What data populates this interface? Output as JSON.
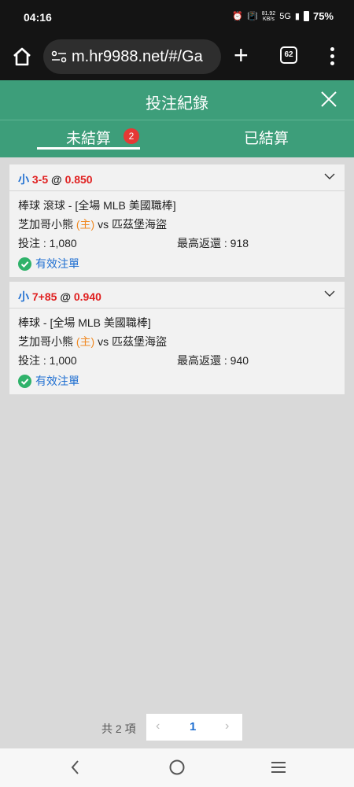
{
  "status": {
    "time": "04:16",
    "net_speed_top": "81.92",
    "net_speed_unit": "KB/s",
    "network": "5G",
    "battery": "75%"
  },
  "browser": {
    "url": "m.hr9988.net/#/Ga",
    "tab_count": "62"
  },
  "header": {
    "title": "投注紀錄"
  },
  "tabs": [
    {
      "label": "未結算",
      "badge": "2"
    },
    {
      "label": "已結算"
    }
  ],
  "bets": [
    {
      "pick_side": "小",
      "pick_line": "3-5",
      "at": "@",
      "odds": "0.850",
      "sport_line": "棒球 滾球 - [全場 MLB 美國職棒]",
      "home_team": "芝加哥小熊",
      "home_tag": "(主)",
      "vs": "vs",
      "away_team": "匹茲堡海盜",
      "stake_label": "投注 : 1,080",
      "return_label": "最高返還 : 918",
      "status": "有效注單"
    },
    {
      "pick_side": "小",
      "pick_line": "7+85",
      "at": "@",
      "odds": "0.940",
      "sport_line": "棒球 - [全場 MLB 美國職棒]",
      "home_team": "芝加哥小熊",
      "home_tag": "(主)",
      "vs": "vs",
      "away_team": "匹茲堡海盜",
      "stake_label": "投注 : 1,000",
      "return_label": "最高返還 : 940",
      "status": "有效注單"
    }
  ],
  "pagination": {
    "total": "共 2 項",
    "prev": "‹",
    "page": "1",
    "next": "›"
  },
  "colors": {
    "header_green": "#3d9e7a",
    "link_blue": "#1f6fd1",
    "odds_red": "#e02020",
    "home_orange": "#f08a24",
    "valid_green": "#2fb26a"
  }
}
